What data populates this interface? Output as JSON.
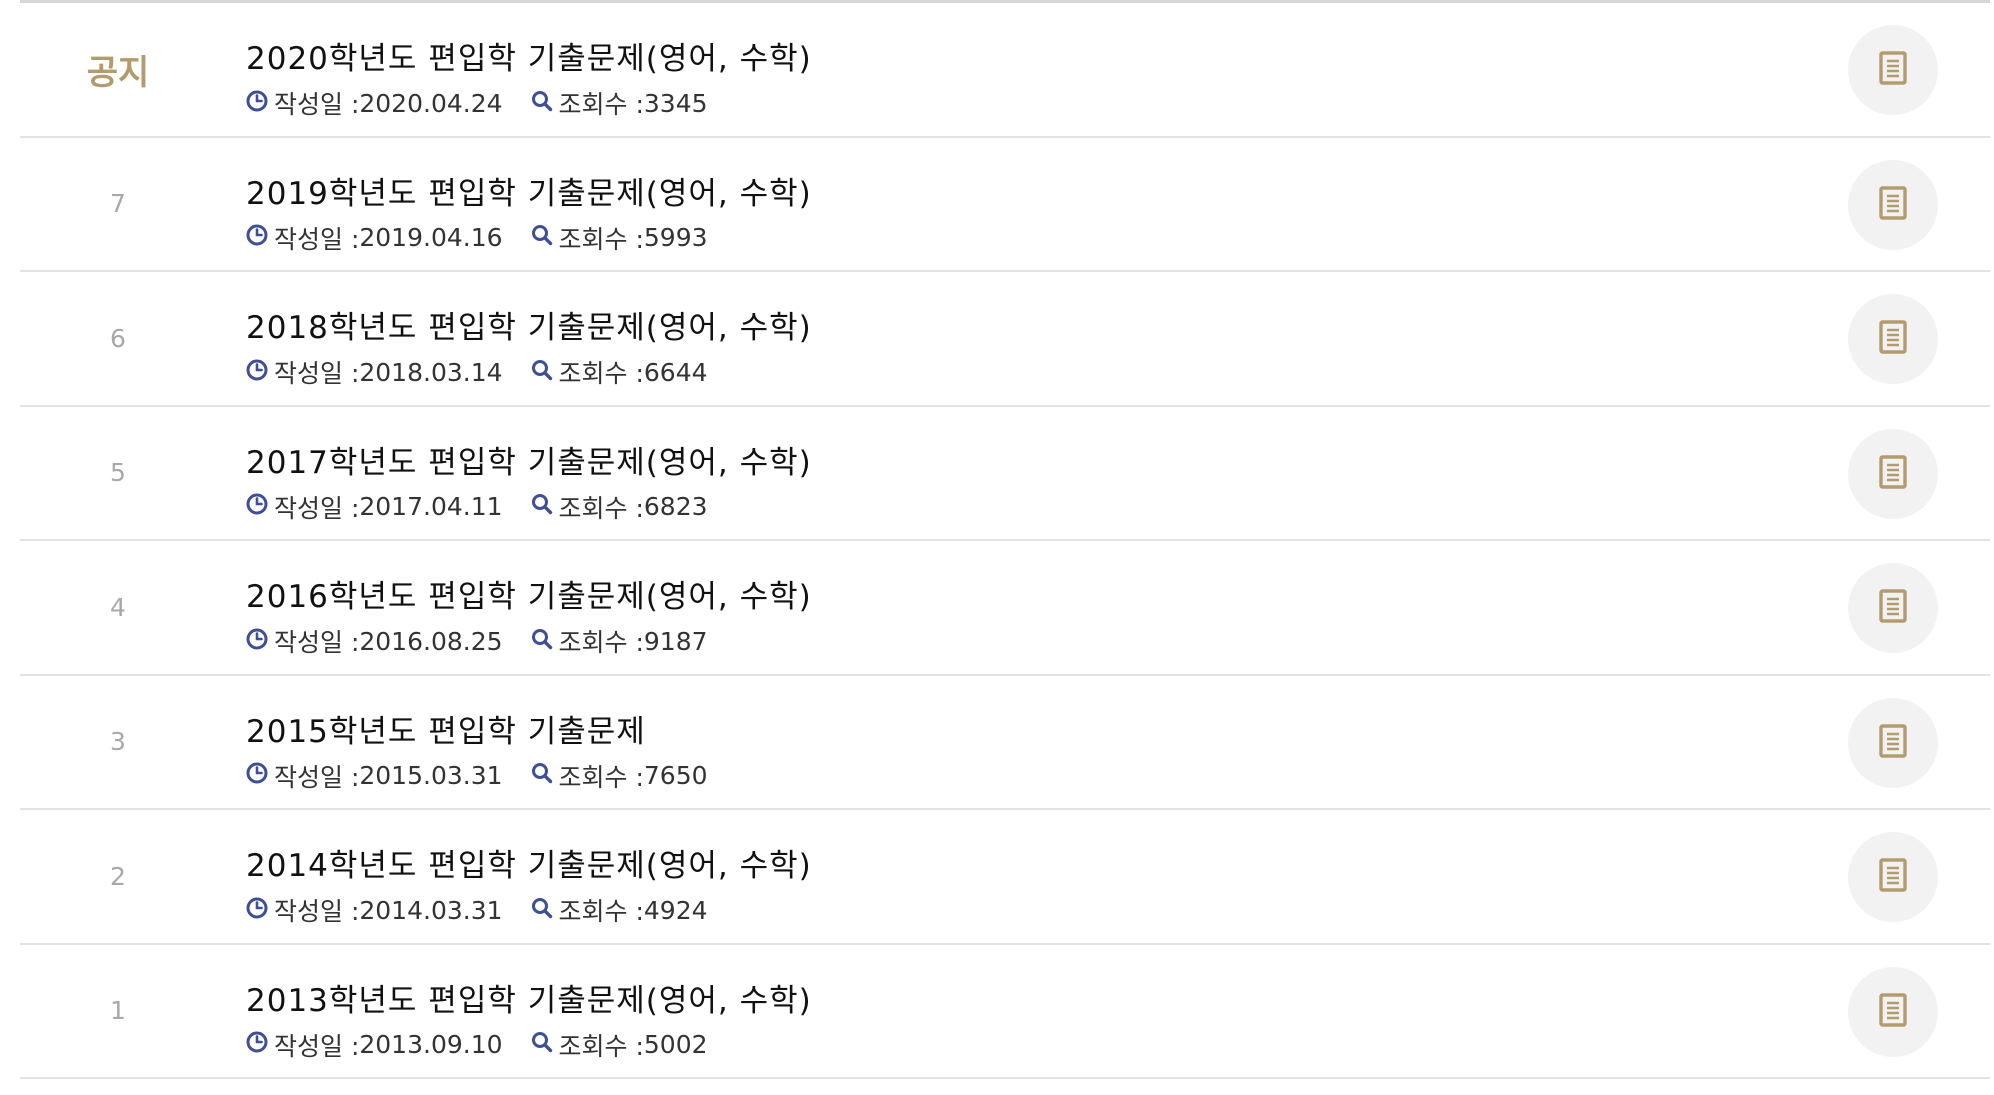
{
  "colors": {
    "accent": "#b39b6e",
    "icon_blue": "#3e4f97",
    "number_gray": "#a8a8a8",
    "divider": "#e3e3e3"
  },
  "labels": {
    "date_label": "작성일 : ",
    "views_label": "조회수 : "
  },
  "icons": {
    "date": "clock-icon",
    "views": "search-icon",
    "file": "document-icon"
  },
  "posts": [
    {
      "number": "공지",
      "title": "2020학년도 편입학 기출문제(영어, 수학)",
      "date": "2020.04.24",
      "views": "3345"
    },
    {
      "number": "7",
      "title": "2019학년도 편입학 기출문제(영어, 수학)",
      "date": "2019.04.16",
      "views": "5993"
    },
    {
      "number": "6",
      "title": "2018학년도 편입학 기출문제(영어, 수학)",
      "date": "2018.03.14",
      "views": "6644"
    },
    {
      "number": "5",
      "title": "2017학년도 편입학 기출문제(영어, 수학)",
      "date": "2017.04.11",
      "views": "6823"
    },
    {
      "number": "4",
      "title": "2016학년도 편입학 기출문제(영어, 수학)",
      "date": "2016.08.25",
      "views": "9187"
    },
    {
      "number": "3",
      "title": "2015학년도 편입학 기출문제",
      "date": "2015.03.31",
      "views": "7650"
    },
    {
      "number": "2",
      "title": "2014학년도 편입학 기출문제(영어, 수학)",
      "date": "2014.03.31",
      "views": "4924"
    },
    {
      "number": "1",
      "title": "2013학년도 편입학 기출문제(영어, 수학)",
      "date": "2013.09.10",
      "views": "5002"
    }
  ]
}
